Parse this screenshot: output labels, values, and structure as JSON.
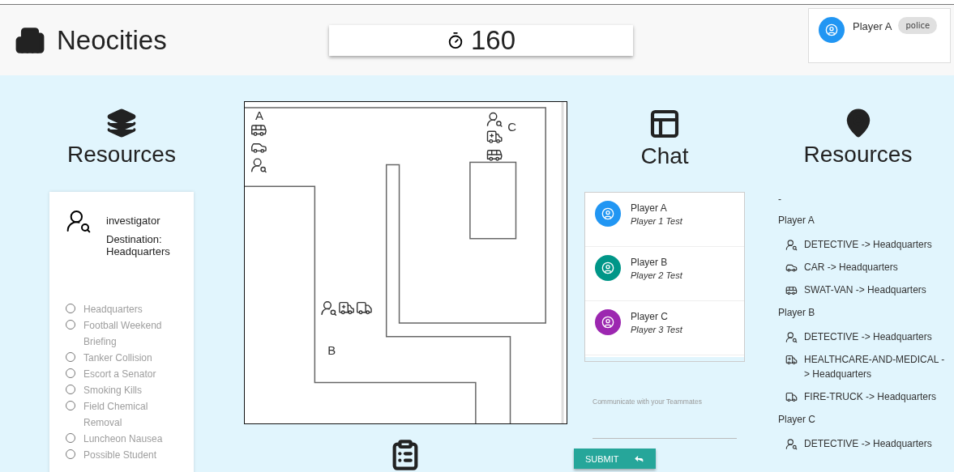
{
  "header": {
    "title": "Neocities",
    "timer": "160",
    "player": {
      "name": "Player A",
      "role": "police"
    }
  },
  "left_panel": {
    "title": "Resources",
    "card": {
      "kind": "detective",
      "name": "investigator",
      "destination_label": "Destination:",
      "destination": "Headquarters"
    },
    "locations": [
      {
        "label": "Headquarters",
        "selected": false
      },
      {
        "label": "Football Weekend Briefing",
        "selected": false
      },
      {
        "label": "Tanker Collision",
        "selected": false
      },
      {
        "label": "Escort a Senator",
        "selected": false
      },
      {
        "label": "Smoking Kills",
        "selected": false
      },
      {
        "label": "Field Chemical Removal",
        "selected": false
      },
      {
        "label": "Luncheon Nausea",
        "selected": false
      },
      {
        "label": "Possible Student",
        "selected": false
      }
    ]
  },
  "map": {
    "markers": [
      {
        "label": "A",
        "units": [
          {
            "kind": "swat-van"
          },
          {
            "kind": "car"
          },
          {
            "kind": "detective"
          }
        ]
      },
      {
        "label": "B",
        "units": [
          {
            "kind": "detective"
          },
          {
            "kind": "medical"
          },
          {
            "kind": "fire-truck"
          }
        ]
      },
      {
        "label": "C",
        "units": [
          {
            "kind": "detective"
          },
          {
            "kind": "medical"
          },
          {
            "kind": "swat-van"
          }
        ]
      }
    ]
  },
  "chat": {
    "title": "Chat",
    "messages": [
      {
        "player": "Player A",
        "text": "Player 1 Test",
        "color": "#2196f3"
      },
      {
        "player": "Player B",
        "text": "Player 2 Test",
        "color": "#009688"
      },
      {
        "player": "Player C",
        "text": "Player 3 Test",
        "color": "#9c27b0"
      }
    ],
    "input": {
      "placeholder": "Communicate with your Teammates"
    },
    "submit": "SUBMIT"
  },
  "right_panel": {
    "title": "Resources",
    "dash": "-",
    "groups": [
      {
        "player": "Player A",
        "items": [
          {
            "kind": "detective",
            "text": "DETECTIVE -> Headquarters"
          },
          {
            "kind": "car",
            "text": "CAR -> Headquarters"
          },
          {
            "kind": "swat-van",
            "text": "SWAT-VAN -> Headquarters"
          }
        ]
      },
      {
        "player": "Player B",
        "items": [
          {
            "kind": "detective",
            "text": "DETECTIVE -> Headquarters"
          },
          {
            "kind": "medical",
            "text": "HEALTHCARE-AND-MEDICAL -> Headquarters"
          },
          {
            "kind": "fire-truck",
            "text": "FIRE-TRUCK -> Headquarters"
          }
        ]
      },
      {
        "player": "Player C",
        "items": [
          {
            "kind": "detective",
            "text": "DETECTIVE -> Headquarters"
          }
        ]
      }
    ]
  }
}
